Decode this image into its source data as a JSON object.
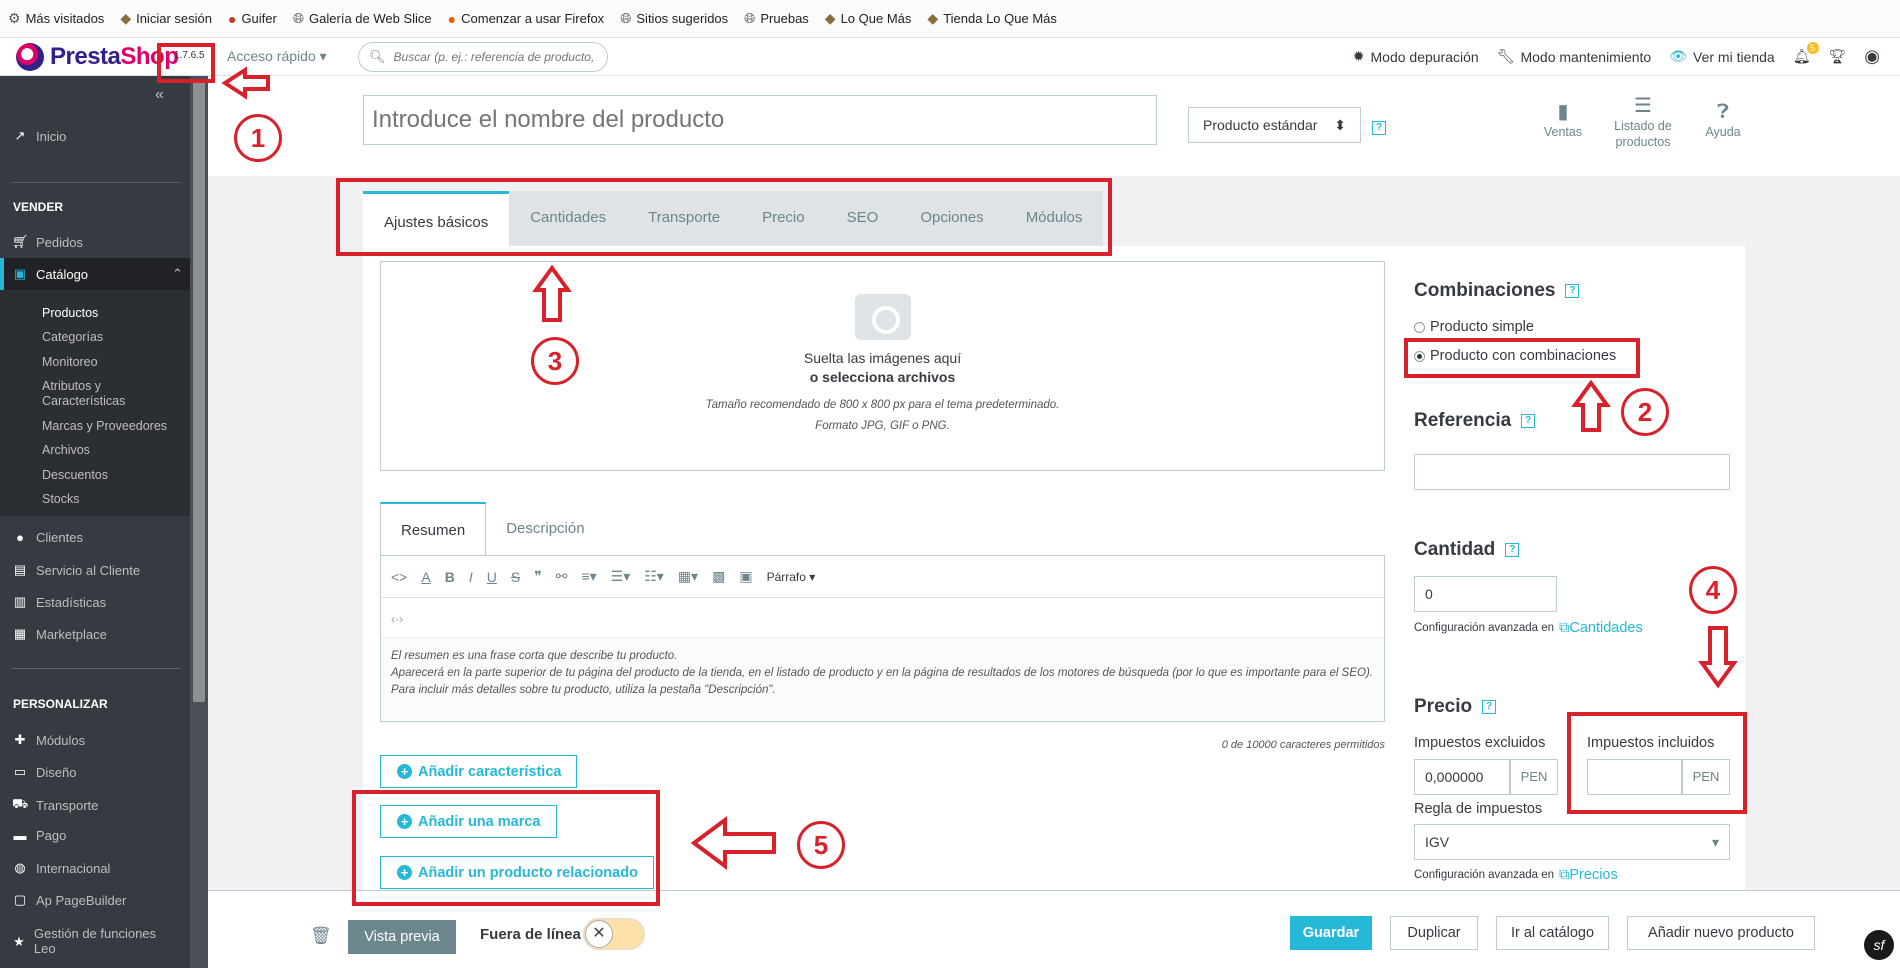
{
  "bookmarks": [
    "Más visitados",
    "Iniciar sesión",
    "Guifer",
    "Galería de Web Slice",
    "Comenzar a usar Firefox",
    "Sitios sugeridos",
    "Pruebas",
    "Lo Que Más",
    "Tienda Lo Que Más"
  ],
  "topbar": {
    "logo_a": "Presta",
    "logo_b": "Shop",
    "version": "1.7.6.5",
    "quick_access": "Acceso rápido",
    "search_placeholder": "Buscar (p. ej.: referencia de producto, n",
    "debug": "Modo depuración",
    "maintenance": "Modo mantenimiento",
    "view_store": "Ver mi tienda",
    "notif_count": "5"
  },
  "sidebar": {
    "home": "Inicio",
    "sell_header": "VENDER",
    "orders": "Pedidos",
    "catalog": "Catálogo",
    "catalog_sub": [
      "Productos",
      "Categorías",
      "Monitoreo",
      "Atributos y Características",
      "Marcas y Proveedores",
      "Archivos",
      "Descuentos",
      "Stocks"
    ],
    "customers": "Clientes",
    "service": "Servicio al Cliente",
    "stats": "Estadísticas",
    "marketplace": "Marketplace",
    "customize_header": "PERSONALIZAR",
    "modules": "Módulos",
    "design": "Diseño",
    "shipping": "Transporte",
    "payment": "Pago",
    "international": "Internacional",
    "pagebuilder": "Ap PageBuilder",
    "leo": "Gestión de funciones Leo"
  },
  "header": {
    "product_name_placeholder": "Introduce el nombre del producto",
    "product_type": "Producto estándar",
    "sales": "Ventas",
    "product_list": "Listado de productos",
    "help": "Ayuda"
  },
  "tabs": [
    "Ajustes básicos",
    "Cantidades",
    "Transporte",
    "Precio",
    "SEO",
    "Opciones",
    "Módulos"
  ],
  "dropzone": {
    "line1": "Suelta las imágenes aquí",
    "line2": "o selecciona archivos",
    "line3": "Tamaño recomendado de 800 x 800 px para el tema predeterminado.",
    "line4": "Formato JPG, GIF o PNG."
  },
  "editor": {
    "tab_summary": "Resumen",
    "tab_description": "Descripción",
    "paragraph": "Párrafo",
    "help1": "El resumen es una frase corta que describe tu producto.",
    "help2": "Aparecerá en la parte superior de tu página del producto de la tienda, en el listado de producto y en la página de resultados de los motores de búsqueda (por lo que es importante para el SEO). Para incluir más detalles sobre tu producto, utiliza la pestaña \"Descripción\".",
    "chars": "0 de 10000 caracteres permitidos"
  },
  "buttons": {
    "add_feature": "Añadir característica",
    "add_brand": "Añadir una marca",
    "add_related": "Añadir un producto relacionado"
  },
  "right": {
    "combinations_title": "Combinaciones",
    "simple": "Producto simple",
    "with_combinations": "Producto con combinaciones",
    "reference_title": "Referencia",
    "quantity_title": "Cantidad",
    "quantity_value": "0",
    "advanced": "Configuración avanzada en",
    "quantities_link": "Cantidades",
    "price_title": "Precio",
    "tax_excl": "Impuestos excluidos",
    "tax_incl": "Impuestos incluidos",
    "price_value": "0,000000",
    "currency": "PEN",
    "tax_rule": "Regla de impuestos",
    "tax_rule_value": "IGV",
    "prices_link": "Precios"
  },
  "footer": {
    "preview": "Vista previa",
    "offline": "Fuera de línea",
    "save": "Guardar",
    "duplicate": "Duplicar",
    "go_catalog": "Ir al catálogo",
    "add_new": "Añadir nuevo producto"
  },
  "annotations": [
    "1",
    "2",
    "3",
    "4",
    "5"
  ]
}
